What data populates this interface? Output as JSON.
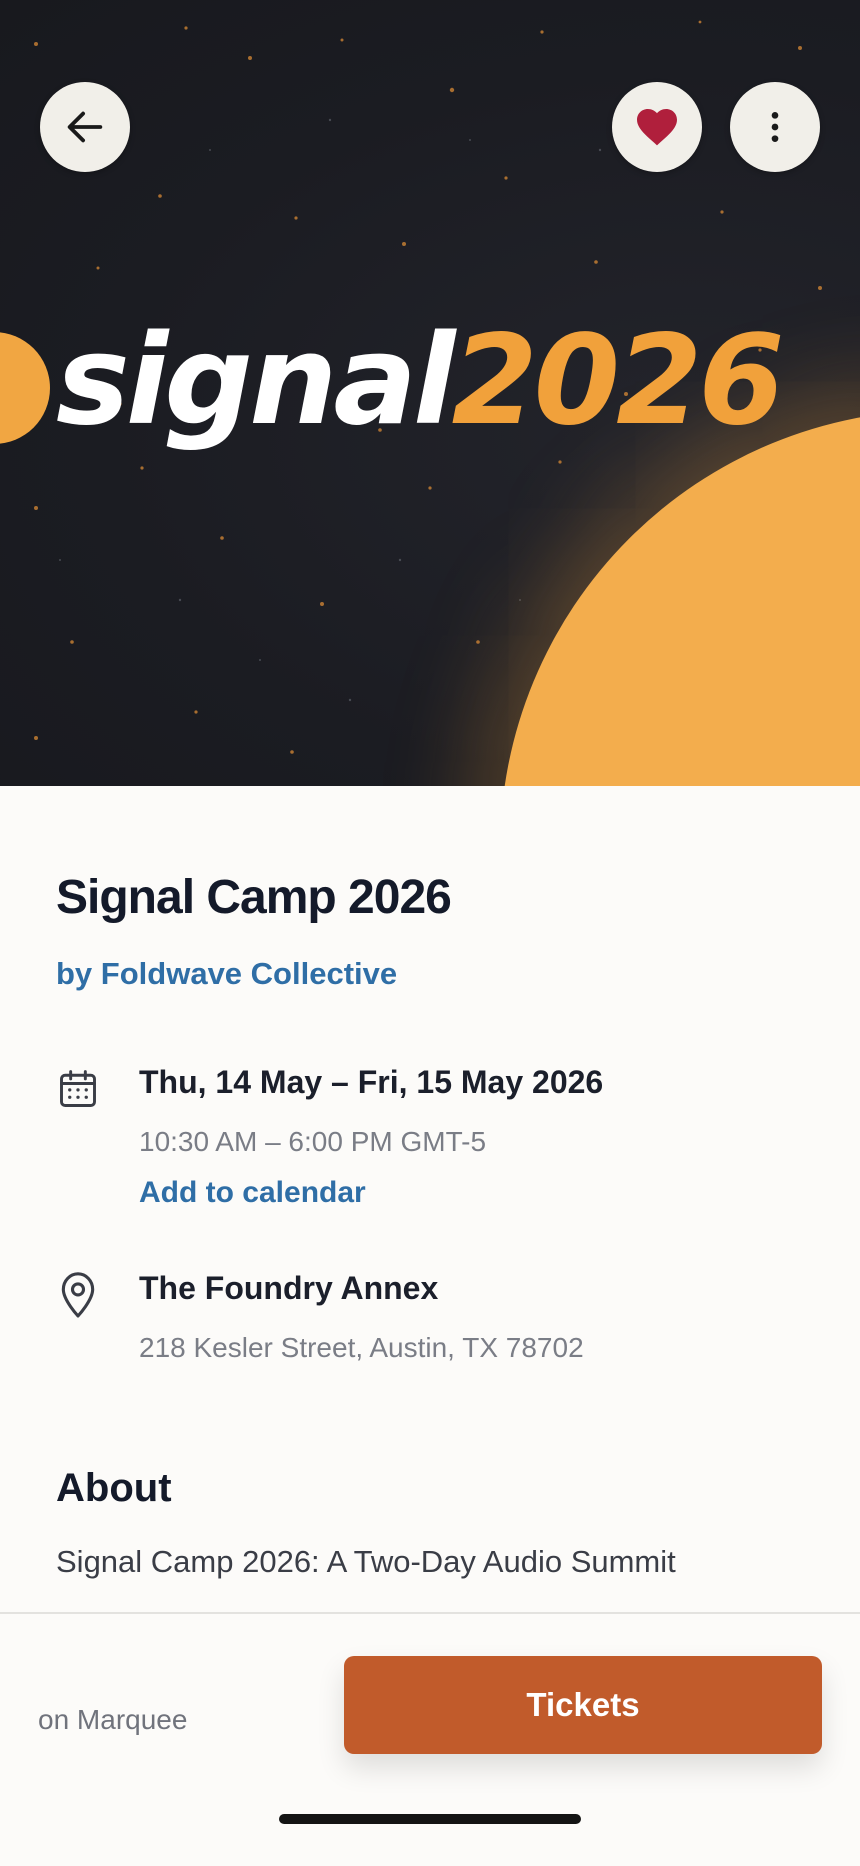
{
  "hero": {
    "logo_word": "signal",
    "logo_year": "2026",
    "colors": {
      "background": "#1b1c22",
      "accent": "#f1a13b",
      "sun": "#f3ad4d"
    }
  },
  "nav": {
    "back_icon": "arrow-left-icon",
    "favorite_icon": "heart-icon",
    "favorite_color": "#b01f3c",
    "more_icon": "more-vertical-icon"
  },
  "event": {
    "title": "Signal Camp 2026",
    "organizer": "by Foldwave Collective",
    "date": {
      "icon": "calendar-icon",
      "range": "Thu, 14 May – Fri, 15 May 2026",
      "time": "10:30 AM – 6:00 PM GMT-5",
      "add_to_calendar": "Add to calendar"
    },
    "location": {
      "icon": "map-pin-icon",
      "venue": "The Foundry Annex",
      "address": "218 Kesler Street, Austin, TX 78702"
    },
    "about": {
      "heading": "About",
      "text": "Signal Camp 2026: A Two-Day Audio Summit"
    }
  },
  "footer": {
    "platform": "on Marquee",
    "tickets_label": "Tickets",
    "button_color": "#c15b2b"
  }
}
